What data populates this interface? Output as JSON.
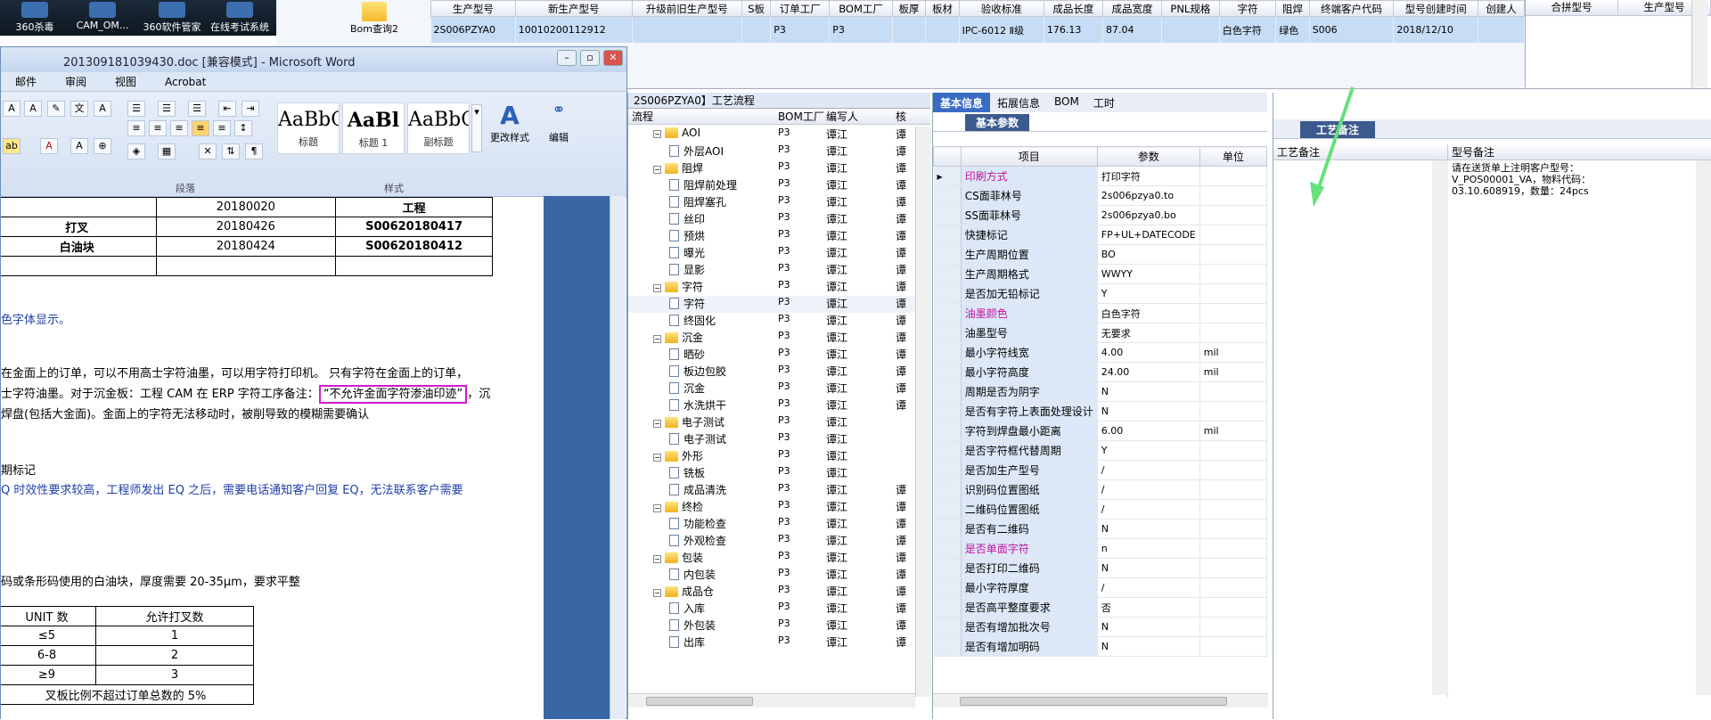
{
  "desktop": {
    "icons": [
      "360杀毒",
      "CAM_OM...",
      "360软件管家",
      "在线考试系统"
    ]
  },
  "erp_top": {
    "bom_query_label": "Bom查询2",
    "grid_headers": [
      "生产型号",
      "新生产型号",
      "升级前旧生产型号",
      "S板",
      "订单工厂",
      "BOM工厂",
      "板厚",
      "板材",
      "验收标准",
      "成品长度",
      "成品宽度",
      "PNL规格",
      "字符",
      "阻焊",
      "终端客户代码",
      "型号创建时间",
      "创建人"
    ],
    "grid_row": [
      "2S006PZYA0",
      "10010200112912",
      "",
      "",
      "P3",
      "P3",
      "",
      "",
      "IPC-6012 Ⅱ级",
      "176.13",
      "87.04",
      "",
      "白色字符",
      "绿色",
      "S006",
      "2018/12/10",
      ""
    ],
    "right_headers": [
      "合拼型号",
      "生产型号"
    ]
  },
  "word": {
    "title": "201309181039430.doc [兼容模式] - Microsoft Word",
    "menu": [
      "邮件",
      "审阅",
      "视图",
      "Acrobat"
    ],
    "styles": [
      {
        "preview": "AaBbC",
        "label": "标题"
      },
      {
        "preview": "AaBl",
        "label": "标题 1"
      },
      {
        "preview": "AaBbC",
        "label": "副标题"
      }
    ],
    "change_styles": "更改样式",
    "edit": "编辑",
    "group_paragraph": "段落",
    "group_styles": "样式",
    "table_rows": [
      [
        "",
        "20180020",
        "工程"
      ],
      [
        "打叉",
        "20180426",
        "S00620180417"
      ],
      [
        "白油块",
        "20180424",
        "S00620180412"
      ]
    ],
    "lines": [
      "色字体显示。",
      "在金面上的订单，可以不用高士字符油墨，可以用字符打印机。 只有字符在金面上的订单，",
      "士字符油墨。对于沉金板：工程 CAM 在 ERP 字符工序备注：",
      "“不允许金面字符渗油印迹”",
      "，沉",
      "焊盘(包括大金面)。金面上的字符无法移动时，被削导致的模糊需要确认",
      "期标记",
      "Q 时效性要求较高，工程师发出 EQ 之后，需要电话通知客户回复 EQ，无法联系客户需要",
      "码或条形码使用的白油块，厚度需要 20-35μm，要求平整"
    ],
    "unit_table": {
      "headers": [
        "UNIT 数",
        "允许打叉数"
      ],
      "rows": [
        [
          "≤5",
          "1"
        ],
        [
          "6-8",
          "2"
        ],
        [
          "≥9",
          "3"
        ]
      ],
      "footer": "叉板比例不超过订单总数的 5%"
    }
  },
  "process": {
    "title": "2S006PZYA0】工艺流程",
    "headers": [
      "流程",
      "BOM工厂",
      "编写人",
      "核"
    ],
    "rows": [
      {
        "level": 1,
        "type": "folder",
        "name": "AOI",
        "f": "P3",
        "w": "谭江",
        "c": "谭"
      },
      {
        "level": 2,
        "type": "doc",
        "name": "外层AOI",
        "f": "P3",
        "w": "谭江",
        "c": "谭"
      },
      {
        "level": 1,
        "type": "folder",
        "name": "阻焊",
        "f": "P3",
        "w": "谭江",
        "c": "谭"
      },
      {
        "level": 2,
        "type": "doc",
        "name": "阻焊前处理",
        "f": "P3",
        "w": "谭江",
        "c": "谭"
      },
      {
        "level": 2,
        "type": "doc",
        "name": "阻焊塞孔",
        "f": "P3",
        "w": "谭江",
        "c": "谭"
      },
      {
        "level": 2,
        "type": "doc",
        "name": "丝印",
        "f": "P3",
        "w": "谭江",
        "c": "谭"
      },
      {
        "level": 2,
        "type": "doc",
        "name": "预烘",
        "f": "P3",
        "w": "谭江",
        "c": "谭"
      },
      {
        "level": 2,
        "type": "doc",
        "name": "曝光",
        "f": "P3",
        "w": "谭江",
        "c": "谭"
      },
      {
        "level": 2,
        "type": "doc",
        "name": "显影",
        "f": "P3",
        "w": "谭江",
        "c": "谭"
      },
      {
        "level": 1,
        "type": "folder",
        "name": "字符",
        "f": "P3",
        "w": "谭江",
        "c": "谭"
      },
      {
        "level": 2,
        "type": "doc",
        "name": "字符",
        "f": "P3",
        "w": "谭江",
        "c": "谭"
      },
      {
        "level": 2,
        "type": "doc",
        "name": "终固化",
        "f": "P3",
        "w": "谭江",
        "c": "谭"
      },
      {
        "level": 1,
        "type": "folder",
        "name": "沉金",
        "f": "P3",
        "w": "谭江",
        "c": "谭"
      },
      {
        "level": 2,
        "type": "doc",
        "name": "晒砂",
        "f": "P3",
        "w": "谭江",
        "c": "谭"
      },
      {
        "level": 2,
        "type": "doc",
        "name": "板边包胶",
        "f": "P3",
        "w": "谭江",
        "c": "谭"
      },
      {
        "level": 2,
        "type": "doc",
        "name": "沉金",
        "f": "P3",
        "w": "谭江",
        "c": "谭"
      },
      {
        "level": 2,
        "type": "doc",
        "name": "水洗烘干",
        "f": "P3",
        "w": "谭江",
        "c": "谭"
      },
      {
        "level": 1,
        "type": "folder",
        "name": "电子测试",
        "f": "P3",
        "w": "谭江",
        "c": ""
      },
      {
        "level": 2,
        "type": "doc",
        "name": "电子测试",
        "f": "P3",
        "w": "谭江",
        "c": ""
      },
      {
        "level": 1,
        "type": "folder",
        "name": "外形",
        "f": "P3",
        "w": "谭江",
        "c": ""
      },
      {
        "level": 2,
        "type": "doc",
        "name": "铣板",
        "f": "P3",
        "w": "谭江",
        "c": ""
      },
      {
        "level": 2,
        "type": "doc",
        "name": "成品清洗",
        "f": "P3",
        "w": "谭江",
        "c": "谭"
      },
      {
        "level": 1,
        "type": "folder",
        "name": "终检",
        "f": "P3",
        "w": "谭江",
        "c": "谭"
      },
      {
        "level": 2,
        "type": "doc",
        "name": "功能检查",
        "f": "P3",
        "w": "谭江",
        "c": "谭"
      },
      {
        "level": 2,
        "type": "doc",
        "name": "外观检查",
        "f": "P3",
        "w": "谭江",
        "c": "谭"
      },
      {
        "level": 1,
        "type": "folder",
        "name": "包装",
        "f": "P3",
        "w": "谭江",
        "c": "谭"
      },
      {
        "level": 2,
        "type": "doc",
        "name": "内包装",
        "f": "P3",
        "w": "谭江",
        "c": "谭"
      },
      {
        "level": 1,
        "type": "folder",
        "name": "成品仓",
        "f": "P3",
        "w": "谭江",
        "c": "谭"
      },
      {
        "level": 2,
        "type": "doc",
        "name": "入库",
        "f": "P3",
        "w": "谭江",
        "c": "谭"
      },
      {
        "level": 2,
        "type": "doc",
        "name": "外包装",
        "f": "P3",
        "w": "谭江",
        "c": "谭"
      },
      {
        "level": 2,
        "type": "doc",
        "name": "出库",
        "f": "P3",
        "w": "谭江",
        "c": "谭"
      }
    ]
  },
  "basic": {
    "tabs": [
      "基本信息",
      "拓展信息",
      "BOM",
      "工时"
    ],
    "subtab": "基本参数",
    "headers": [
      "项目",
      "参数",
      "单位"
    ],
    "rows": [
      {
        "item": "印刷方式",
        "value": "打印字符",
        "unit": "",
        "pink": true
      },
      {
        "item": "CS面菲林号",
        "value": "2s006pzya0.to",
        "unit": ""
      },
      {
        "item": "SS面菲林号",
        "value": "2s006pzya0.bo",
        "unit": ""
      },
      {
        "item": "快捷标记",
        "value": "FP+UL+DATECODE",
        "unit": ""
      },
      {
        "item": "生产周期位置",
        "value": "BO",
        "unit": ""
      },
      {
        "item": "生产周期格式",
        "value": "WWYY",
        "unit": ""
      },
      {
        "item": "是否加无铅标记",
        "value": "Y",
        "unit": ""
      },
      {
        "item": "油墨颜色",
        "value": "白色字符",
        "unit": "",
        "pink": true
      },
      {
        "item": "油墨型号",
        "value": "无要求",
        "unit": ""
      },
      {
        "item": "最小字符线宽",
        "value": "4.00",
        "unit": "mil"
      },
      {
        "item": "最小字符高度",
        "value": "24.00",
        "unit": "mil"
      },
      {
        "item": "周期是否为阴字",
        "value": "N",
        "unit": ""
      },
      {
        "item": "是否有字符上表面处理设计",
        "value": "N",
        "unit": ""
      },
      {
        "item": "字符到焊盘最小距离",
        "value": "6.00",
        "unit": "mil"
      },
      {
        "item": "是否字符框代替周期",
        "value": "Y",
        "unit": ""
      },
      {
        "item": "是否加生产型号",
        "value": "/",
        "unit": ""
      },
      {
        "item": "识别码位置图纸",
        "value": "/",
        "unit": ""
      },
      {
        "item": "二维码位置图纸",
        "value": "/",
        "unit": ""
      },
      {
        "item": "是否有二维码",
        "value": "N",
        "unit": ""
      },
      {
        "item": "是否单面字符",
        "value": "n",
        "unit": "",
        "pink": true
      },
      {
        "item": "是否打印二维码",
        "value": "N",
        "unit": ""
      },
      {
        "item": "最小字符厚度",
        "value": "/",
        "unit": ""
      },
      {
        "item": "是否高平整度要求",
        "value": "否",
        "unit": ""
      },
      {
        "item": "是否有增加批次号",
        "value": "N",
        "unit": ""
      },
      {
        "item": "是否有增加明码",
        "value": "N",
        "unit": ""
      }
    ]
  },
  "notes": {
    "tab": "工艺备注",
    "col1": "工艺备注",
    "col2": "型号备注",
    "model_note": "请在送货单上注明客户型号：V_POS00001_VA，物料代码：03.10.608919，数量：24pcs"
  },
  "colors": {
    "accent_tab": "#3a6cc6",
    "selected_row": "#c7dcf5",
    "highlight_box": "#d01ad0",
    "arrow": "#66e07a"
  }
}
